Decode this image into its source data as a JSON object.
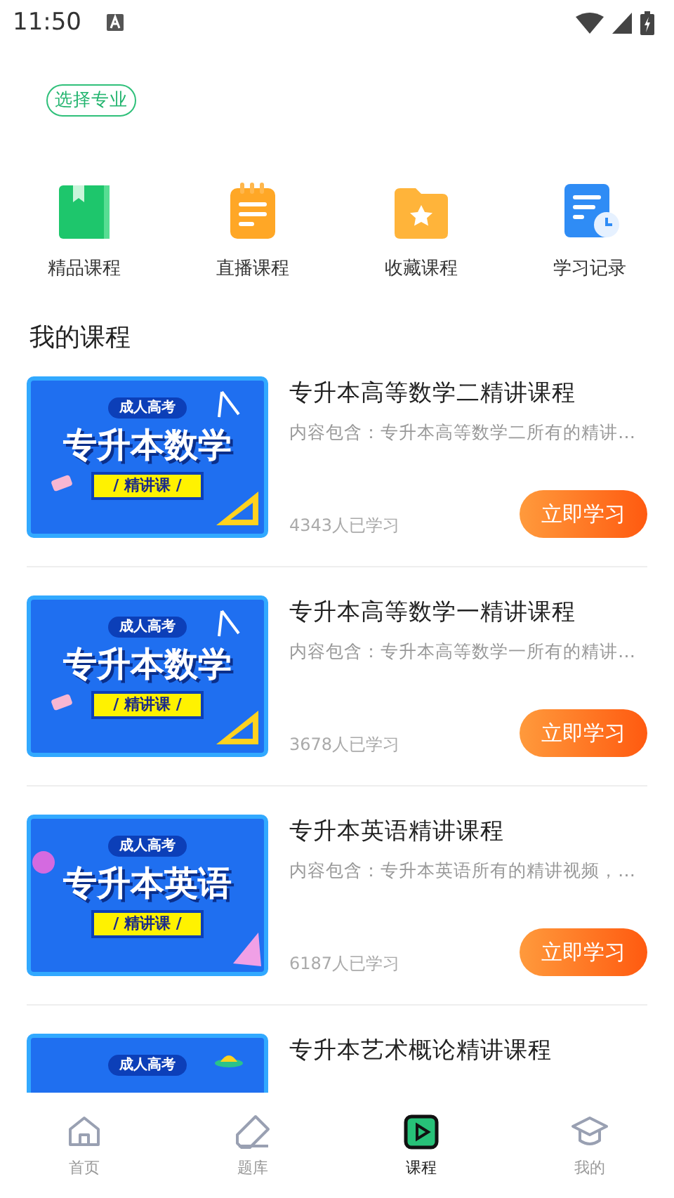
{
  "status_bar": {
    "time": "11:50"
  },
  "major_button": {
    "label": "选择专业"
  },
  "shortcuts": [
    {
      "kind": "book",
      "label": "精品课程"
    },
    {
      "kind": "notepad",
      "label": "直播课程"
    },
    {
      "kind": "folder",
      "label": "收藏课程"
    },
    {
      "kind": "record",
      "label": "学习记录"
    }
  ],
  "section_title": "我的课程",
  "courses": [
    {
      "title": "专升本高等数学二精讲课程",
      "description": "内容包含：专升本高等数学二所有的精讲…",
      "learners": "4343人已学习",
      "button": "立即学习",
      "cover": {
        "kind": "math",
        "badge": "成人高考",
        "title": "专升本数学",
        "tag": "/ 精讲课 /"
      }
    },
    {
      "title": "专升本高等数学一精讲课程",
      "description": "内容包含：专升本高等数学一所有的精讲…",
      "learners": "3678人已学习",
      "button": "立即学习",
      "cover": {
        "kind": "math",
        "badge": "成人高考",
        "title": "专升本数学",
        "tag": "/ 精讲课 /"
      }
    },
    {
      "title": "专升本英语精讲课程",
      "description": "内容包含：专升本英语所有的精讲视频，…",
      "learners": "6187人已学习",
      "button": "立即学习",
      "cover": {
        "kind": "english",
        "badge": "成人高考",
        "title": "专升本英语",
        "tag": "/ 精讲课 /"
      }
    },
    {
      "title": "专升本艺术概论精讲课程",
      "cover": {
        "kind": "art",
        "badge": "成人高考"
      }
    }
  ],
  "tab_bar": [
    {
      "kind": "home",
      "label": "首页",
      "selected": false
    },
    {
      "kind": "pencil",
      "label": "题库",
      "selected": false
    },
    {
      "kind": "video",
      "label": "课程",
      "selected": true
    },
    {
      "kind": "cap",
      "label": "我的",
      "selected": false
    }
  ]
}
